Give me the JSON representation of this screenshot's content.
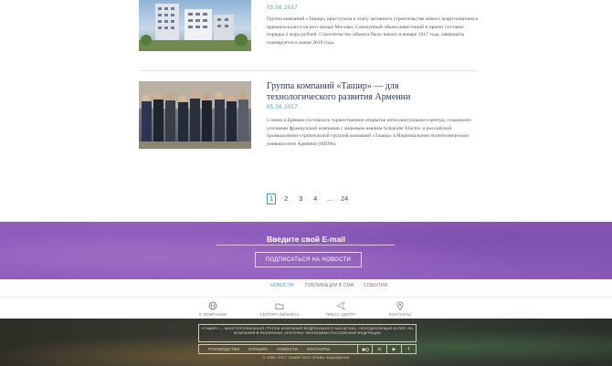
{
  "news": [
    {
      "date": "05.06.2017",
      "text": "Группа компаний «Ташир» приступила к этапу активного строительства нового апарт-комплекса премиум-класса на юго-западе Москвы. Совокупный объем инвестиций в проект составит порядка 2 млрд рублей. Строительство объекта было начато в январе 2017 года, завершить планируется в конце 2018 года."
    },
    {
      "title": "Группа компаний «Ташир» — для технологического развития Армении",
      "date": "05.06.2017",
      "text": "5 июня в Ереване состоялось торжественное открытие интеллектуального центра, созданного усилиями французской компании с мировым именем Schneider Electric и российской промышленно-строительной группой компаний «Ташир» в Национальном политехническом университете Армении (НПУА)."
    }
  ],
  "pagination": {
    "pages": [
      "1",
      "2",
      "3",
      "4",
      "...",
      "24"
    ],
    "active": "1"
  },
  "subscribe": {
    "title": "Введите свой E-mail",
    "button": "ПОДПИСАТЬСЯ НА НОВОСТИ"
  },
  "subnav": [
    "НОВОСТИ",
    "ПУБЛИКАЦИИ В СМИ",
    "СОБЫТИЯ"
  ],
  "iconnav": [
    {
      "label": "О КОМПАНИИ",
      "icon": "globe-icon"
    },
    {
      "label": "СЕКТОРА БИЗНЕСА",
      "icon": "folder-icon"
    },
    {
      "label": "ПРЕСС-ЦЕНТР",
      "icon": "send-icon"
    },
    {
      "label": "КОНТАКТЫ",
      "icon": "map-pin-icon"
    }
  ],
  "footer": {
    "about": "«ТАШИР» — МНОГОПРОФИЛЬНАЯ ГРУППА КОМПАНИЙ ФЕДЕРАЛЬНОГО МАСШТАБА, ОБЪЕДИНЯЮЩАЯ БОЛЕЕ 200 КОМПАНИЙ В РАЗЛИЧНЫХ СЕКТОРАХ ЭКОНОМИКИ РОССИЙСКОЙ ФЕДЕРАЦИИ",
    "links": [
      "РУКОВОДСТВО",
      "КАРЬЕРА",
      "НОВОСТИ",
      "КОНТАКТЫ"
    ],
    "social": [
      "flickr-icon",
      "linkedin-icon",
      "youtube-icon",
      "facebook-icon"
    ],
    "copyright": "© 1999–2017 ТАШИР ВСЕ ПРАВА ЗАЩИЩЕНЫ"
  },
  "colors": {
    "accent": "#4aa0b5",
    "subscribe_bg": "#8d5cbb",
    "footer_bg": "#33362e"
  }
}
